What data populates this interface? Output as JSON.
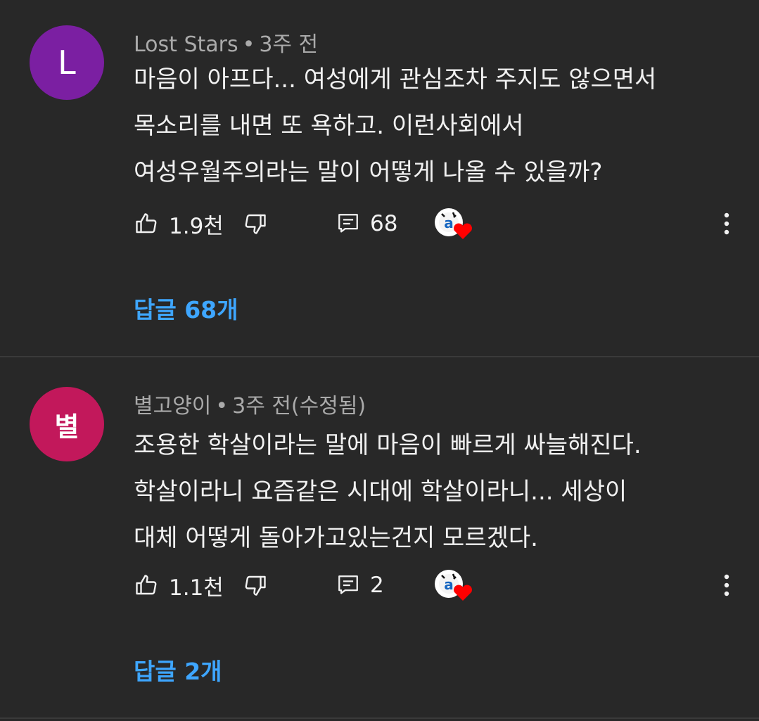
{
  "comments": [
    {
      "avatar_letter": "L",
      "avatar_color": "#7b1fa2",
      "author": "Lost Stars",
      "separator": "•",
      "time": "3주 전",
      "lines": [
        "마음이 아프다... 여성에게 관심조차 주지도 않으면서",
        "목소리를 내면 또 욕하고. 이런사회에서",
        "여성우월주의라는 말이 어떻게 나올 수 있을까?"
      ],
      "likes": "1.9천",
      "reply_count": "68",
      "replies_link": "답글 68개",
      "like_icon": "thumbs-up-icon",
      "dislike_icon": "thumbs-down-icon",
      "reply_icon": "comment-icon",
      "heart_icon": "creator-heart-icon",
      "more_icon": "more-vert-icon"
    },
    {
      "avatar_letter": "별",
      "avatar_color": "#c2185b",
      "author": "별고양이",
      "separator": "•",
      "time": "3주 전(수정됨)",
      "lines": [
        "조용한 학살이라는 말에 마음이 빠르게 싸늘해진다.",
        "학살이라니 요즘같은 시대에 학살이라니... 세상이",
        "대체 어떻게 돌아가고있는건지 모르겠다."
      ],
      "likes": "1.1천",
      "reply_count": "2",
      "replies_link": "답글 2개",
      "like_icon": "thumbs-up-icon",
      "dislike_icon": "thumbs-down-icon",
      "reply_icon": "comment-icon",
      "heart_icon": "creator-heart-icon",
      "more_icon": "more-vert-icon"
    }
  ],
  "colors": {
    "background": "#282828",
    "link": "#3ea6ff",
    "secondary_text": "#aaaaaa",
    "heart": "#ff0000"
  }
}
